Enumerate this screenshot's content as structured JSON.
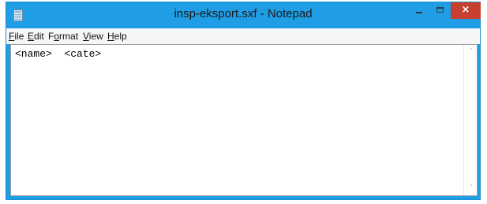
{
  "window": {
    "title": "insp-eksport.sxf - Notepad",
    "close_glyph": "×",
    "icon": "notepad-icon"
  },
  "menu": [
    {
      "mnemonic": "F",
      "rest": "ile"
    },
    {
      "mnemonic": "E",
      "rest": "dit"
    },
    {
      "mnemonic": "o",
      "prefix": "F",
      "rest": "rmat"
    },
    {
      "mnemonic": "V",
      "rest": "iew"
    },
    {
      "mnemonic": "H",
      "rest": "elp"
    }
  ],
  "editor": {
    "content": "<name>  <cate>"
  },
  "scrollbar": {
    "up_glyph": "˄",
    "down_glyph": "˅"
  },
  "colors": {
    "frame": "#1f9ee6",
    "close_button": "#c7402f",
    "menubar": "#f5f6f7"
  }
}
